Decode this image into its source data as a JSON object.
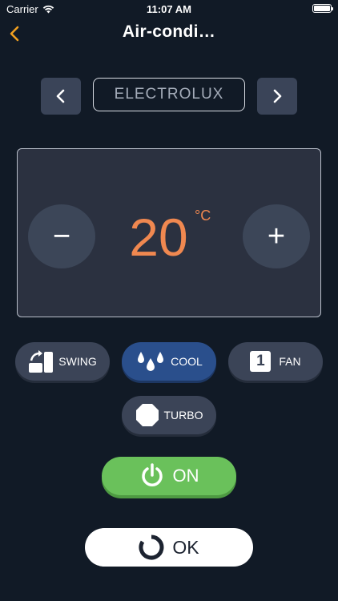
{
  "status_bar": {
    "carrier": "Carrier",
    "time": "11:07 AM"
  },
  "nav": {
    "title": "Air-condi…",
    "back_icon": "chevron-left-icon"
  },
  "brand": {
    "name": "ELECTROLUX",
    "prev_icon": "chevron-left-icon",
    "next_icon": "chevron-right-icon"
  },
  "temperature": {
    "value": "20",
    "unit": "°C",
    "minus_label": "−",
    "plus_label": "+"
  },
  "modes": {
    "swing": {
      "label": "SWING",
      "icon": "swing-icon"
    },
    "cool": {
      "label": "COOL",
      "icon": "water-drops-icon",
      "active": true
    },
    "fan": {
      "label": "FAN",
      "icon_text": "1"
    },
    "turbo": {
      "label": "TURBO",
      "icon": "octagon-icon"
    }
  },
  "power": {
    "label": "ON",
    "icon": "power-icon"
  },
  "confirm": {
    "label": "OK",
    "icon": "ring-icon"
  },
  "colors": {
    "background": "#111a26",
    "accent_temp": "#f08850",
    "power_green": "#6ac15b",
    "active_mode": "#2a4f8c",
    "nav_back": "#f0a020"
  }
}
